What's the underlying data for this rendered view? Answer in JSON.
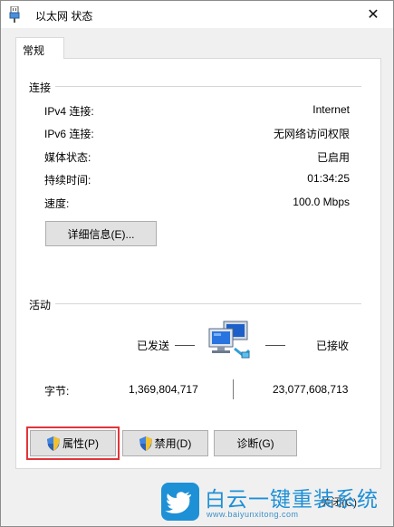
{
  "window": {
    "title": "以太网 状态",
    "close_glyph": "✕"
  },
  "tabs": [
    {
      "label": "常规"
    }
  ],
  "connection": {
    "heading": "连接",
    "rows": [
      {
        "label": "IPv4 连接:",
        "value": "Internet"
      },
      {
        "label": "IPv6 连接:",
        "value": "无网络访问权限"
      },
      {
        "label": "媒体状态:",
        "value": "已启用"
      },
      {
        "label": "持续时间:",
        "value": "01:34:25"
      },
      {
        "label": "速度:",
        "value": "100.0 Mbps"
      }
    ],
    "details_button": "详细信息(E)..."
  },
  "activity": {
    "heading": "活动",
    "sent_label": "已发送",
    "received_label": "已接收",
    "bytes_label": "字节:",
    "bytes_sent": "1,369,804,717",
    "bytes_received": "23,077,608,713"
  },
  "buttons": {
    "properties": "属性(P)",
    "disable": "禁用(D)",
    "diagnose": "诊断(G)",
    "close_partial": "关闭(C)"
  },
  "watermark": {
    "title": "白云一键重装系统",
    "url": "www.baiyunxitong.com"
  },
  "colors": {
    "highlight": "#e0353a",
    "watermark_blue": "#1e90d6",
    "button_face": "#e1e1e1"
  },
  "icons": [
    "ethernet-icon",
    "close-icon",
    "network-computers-icon",
    "uac-shield-icon",
    "twitter-bird-icon"
  ]
}
